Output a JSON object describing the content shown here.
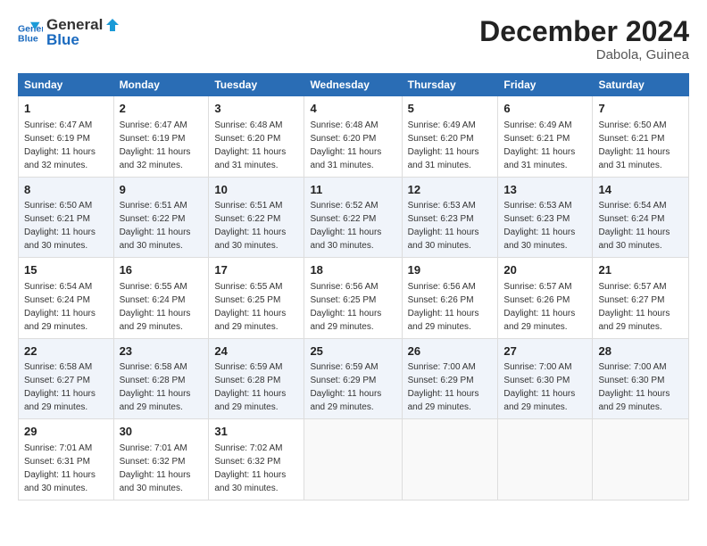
{
  "logo": {
    "line1": "General",
    "line2": "Blue"
  },
  "title": "December 2024",
  "subtitle": "Dabola, Guinea",
  "days_of_week": [
    "Sunday",
    "Monday",
    "Tuesday",
    "Wednesday",
    "Thursday",
    "Friday",
    "Saturday"
  ],
  "weeks": [
    [
      {
        "day": "1",
        "sunrise": "6:47 AM",
        "sunset": "6:19 PM",
        "daylight": "11 hours and 32 minutes."
      },
      {
        "day": "2",
        "sunrise": "6:47 AM",
        "sunset": "6:19 PM",
        "daylight": "11 hours and 32 minutes."
      },
      {
        "day": "3",
        "sunrise": "6:48 AM",
        "sunset": "6:20 PM",
        "daylight": "11 hours and 31 minutes."
      },
      {
        "day": "4",
        "sunrise": "6:48 AM",
        "sunset": "6:20 PM",
        "daylight": "11 hours and 31 minutes."
      },
      {
        "day": "5",
        "sunrise": "6:49 AM",
        "sunset": "6:20 PM",
        "daylight": "11 hours and 31 minutes."
      },
      {
        "day": "6",
        "sunrise": "6:49 AM",
        "sunset": "6:21 PM",
        "daylight": "11 hours and 31 minutes."
      },
      {
        "day": "7",
        "sunrise": "6:50 AM",
        "sunset": "6:21 PM",
        "daylight": "11 hours and 31 minutes."
      }
    ],
    [
      {
        "day": "8",
        "sunrise": "6:50 AM",
        "sunset": "6:21 PM",
        "daylight": "11 hours and 30 minutes."
      },
      {
        "day": "9",
        "sunrise": "6:51 AM",
        "sunset": "6:22 PM",
        "daylight": "11 hours and 30 minutes."
      },
      {
        "day": "10",
        "sunrise": "6:51 AM",
        "sunset": "6:22 PM",
        "daylight": "11 hours and 30 minutes."
      },
      {
        "day": "11",
        "sunrise": "6:52 AM",
        "sunset": "6:22 PM",
        "daylight": "11 hours and 30 minutes."
      },
      {
        "day": "12",
        "sunrise": "6:53 AM",
        "sunset": "6:23 PM",
        "daylight": "11 hours and 30 minutes."
      },
      {
        "day": "13",
        "sunrise": "6:53 AM",
        "sunset": "6:23 PM",
        "daylight": "11 hours and 30 minutes."
      },
      {
        "day": "14",
        "sunrise": "6:54 AM",
        "sunset": "6:24 PM",
        "daylight": "11 hours and 30 minutes."
      }
    ],
    [
      {
        "day": "15",
        "sunrise": "6:54 AM",
        "sunset": "6:24 PM",
        "daylight": "11 hours and 29 minutes."
      },
      {
        "day": "16",
        "sunrise": "6:55 AM",
        "sunset": "6:24 PM",
        "daylight": "11 hours and 29 minutes."
      },
      {
        "day": "17",
        "sunrise": "6:55 AM",
        "sunset": "6:25 PM",
        "daylight": "11 hours and 29 minutes."
      },
      {
        "day": "18",
        "sunrise": "6:56 AM",
        "sunset": "6:25 PM",
        "daylight": "11 hours and 29 minutes."
      },
      {
        "day": "19",
        "sunrise": "6:56 AM",
        "sunset": "6:26 PM",
        "daylight": "11 hours and 29 minutes."
      },
      {
        "day": "20",
        "sunrise": "6:57 AM",
        "sunset": "6:26 PM",
        "daylight": "11 hours and 29 minutes."
      },
      {
        "day": "21",
        "sunrise": "6:57 AM",
        "sunset": "6:27 PM",
        "daylight": "11 hours and 29 minutes."
      }
    ],
    [
      {
        "day": "22",
        "sunrise": "6:58 AM",
        "sunset": "6:27 PM",
        "daylight": "11 hours and 29 minutes."
      },
      {
        "day": "23",
        "sunrise": "6:58 AM",
        "sunset": "6:28 PM",
        "daylight": "11 hours and 29 minutes."
      },
      {
        "day": "24",
        "sunrise": "6:59 AM",
        "sunset": "6:28 PM",
        "daylight": "11 hours and 29 minutes."
      },
      {
        "day": "25",
        "sunrise": "6:59 AM",
        "sunset": "6:29 PM",
        "daylight": "11 hours and 29 minutes."
      },
      {
        "day": "26",
        "sunrise": "7:00 AM",
        "sunset": "6:29 PM",
        "daylight": "11 hours and 29 minutes."
      },
      {
        "day": "27",
        "sunrise": "7:00 AM",
        "sunset": "6:30 PM",
        "daylight": "11 hours and 29 minutes."
      },
      {
        "day": "28",
        "sunrise": "7:00 AM",
        "sunset": "6:30 PM",
        "daylight": "11 hours and 29 minutes."
      }
    ],
    [
      {
        "day": "29",
        "sunrise": "7:01 AM",
        "sunset": "6:31 PM",
        "daylight": "11 hours and 30 minutes."
      },
      {
        "day": "30",
        "sunrise": "7:01 AM",
        "sunset": "6:32 PM",
        "daylight": "11 hours and 30 minutes."
      },
      {
        "day": "31",
        "sunrise": "7:02 AM",
        "sunset": "6:32 PM",
        "daylight": "11 hours and 30 minutes."
      },
      null,
      null,
      null,
      null
    ]
  ],
  "labels": {
    "sunrise": "Sunrise: ",
    "sunset": "Sunset: ",
    "daylight": "Daylight: "
  }
}
